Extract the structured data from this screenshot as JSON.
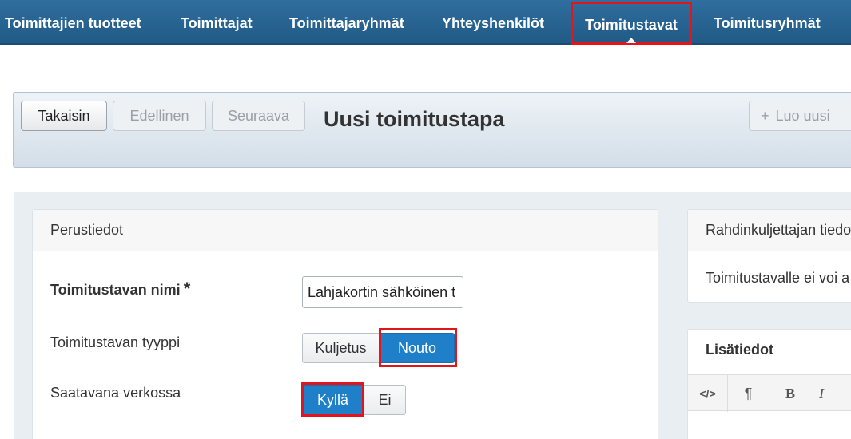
{
  "nav": {
    "items": [
      {
        "label": "Toimittajien tuotteet"
      },
      {
        "label": "Toimittajat"
      },
      {
        "label": "Toimittajaryhmät"
      },
      {
        "label": "Yhteyshenkilöt"
      },
      {
        "label": "Toimitustavat",
        "active": true
      },
      {
        "label": "Toimitusryhmät"
      }
    ]
  },
  "toolbar": {
    "back_label": "Takaisin",
    "prev_label": "Edellinen",
    "next_label": "Seuraava",
    "title": "Uusi toimitustapa",
    "create_label": "Luo uusi",
    "create_icon": "plus-icon"
  },
  "basic_info": {
    "header": "Perustiedot",
    "name_label": "Toimitustavan nimi",
    "required_mark": "*",
    "name_value": "Lahjakortin sähköinen t",
    "type_label": "Toimitustavan tyyppi",
    "type_options": [
      "Kuljetus",
      "Nouto"
    ],
    "type_selected": "Nouto",
    "online_label": "Saatavana verkossa",
    "online_options": [
      "Kyllä",
      "Ei"
    ],
    "online_selected": "Kyllä"
  },
  "carrier": {
    "header": "Rahdinkuljettajan tiedo",
    "text": "Toimitustavalle ei voi a"
  },
  "additional": {
    "header": "Lisätiedot",
    "editor_buttons": [
      {
        "label": "</>",
        "icon": "code-view-icon"
      },
      {
        "label": "¶",
        "icon": "paragraph-icon"
      },
      {
        "label": "B",
        "icon": "bold-icon"
      },
      {
        "label": "I",
        "icon": "italic-icon"
      }
    ]
  },
  "colors": {
    "nav_bg": "#215a86",
    "highlight": "#e2141c",
    "selected_toggle": "#1f7fc9"
  }
}
